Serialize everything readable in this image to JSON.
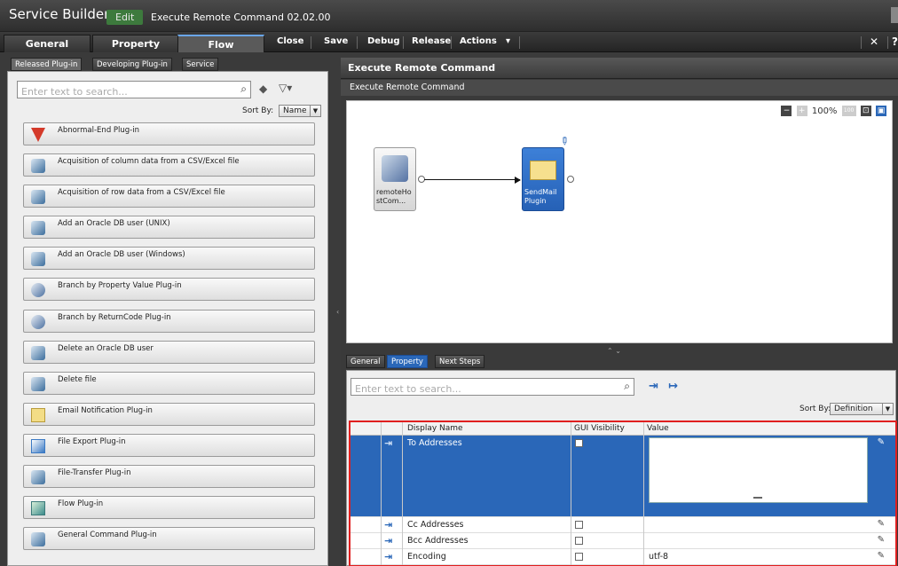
{
  "app": {
    "name": "Service Builder",
    "mode_badge": "Edit",
    "service_title": "Execute Remote Command 02.02.00"
  },
  "toolbar": {
    "tabs": [
      "General",
      "Property",
      "Flow"
    ],
    "active_tab": "Flow",
    "actions": [
      "Close",
      "Save",
      "Debug",
      "Release",
      "Actions"
    ],
    "actions_dropdown": "▾"
  },
  "left_panel": {
    "tabs": [
      "Released Plug-in",
      "Developing Plug-in",
      "Service"
    ],
    "search_placeholder": "Enter text to search...",
    "sort_by_label": "Sort By:",
    "sort_by_value": "Name",
    "plugins": [
      {
        "label": "Abnormal-End Plug-in",
        "icon": "abnormal-end-icon"
      },
      {
        "label": "Acquisition of column data from a CSV/Excel file",
        "icon": "gear-icon"
      },
      {
        "label": "Acquisition of row data from a CSV/Excel file",
        "icon": "gear-icon"
      },
      {
        "label": "Add an Oracle DB user (UNIX)",
        "icon": "gear-icon"
      },
      {
        "label": "Add an Oracle DB user (Windows)",
        "icon": "gear-icon"
      },
      {
        "label": "Branch by Property Value Plug-in",
        "icon": "branch-icon"
      },
      {
        "label": "Branch by ReturnCode Plug-in",
        "icon": "branch-icon"
      },
      {
        "label": "Delete an Oracle DB user",
        "icon": "gear-icon"
      },
      {
        "label": "Delete file",
        "icon": "gear-icon"
      },
      {
        "label": "Email Notification Plug-in",
        "icon": "mail-icon"
      },
      {
        "label": "File Export Plug-in",
        "icon": "file-export-icon"
      },
      {
        "label": "File-Transfer Plug-in",
        "icon": "file-transfer-icon"
      },
      {
        "label": "Flow Plug-in",
        "icon": "flow-icon"
      },
      {
        "label": "General Command Plug-in",
        "icon": "general-command-icon"
      }
    ]
  },
  "editor": {
    "header": "Execute Remote Command",
    "subheader": "Execute Remote Command",
    "zoom_level": "100%",
    "zoom_reset": "100",
    "nodes": [
      {
        "label_line1": "remoteHo",
        "label_line2": "stCom..."
      },
      {
        "label_line1": "SendMail",
        "label_line2": "Plugin"
      }
    ]
  },
  "bottom_panel": {
    "tabs": [
      "General",
      "Property",
      "Next Steps"
    ],
    "active_tab": "Property",
    "search_placeholder": "Enter text to search...",
    "sort_by_label": "Sort By:",
    "sort_by_value": "Definition",
    "columns": [
      "Display Name",
      "GUI Visibility",
      "Value"
    ],
    "rows": [
      {
        "name": "To Addresses",
        "value": ""
      },
      {
        "name": "Cc Addresses",
        "value": ""
      },
      {
        "name": "Bcc Addresses",
        "value": ""
      },
      {
        "name": "Encoding",
        "value": "utf-8"
      }
    ]
  },
  "colors": {
    "accent_blue": "#2a67b8",
    "highlight_red": "#e01f1f",
    "edit_green": "#3d7a3d"
  }
}
